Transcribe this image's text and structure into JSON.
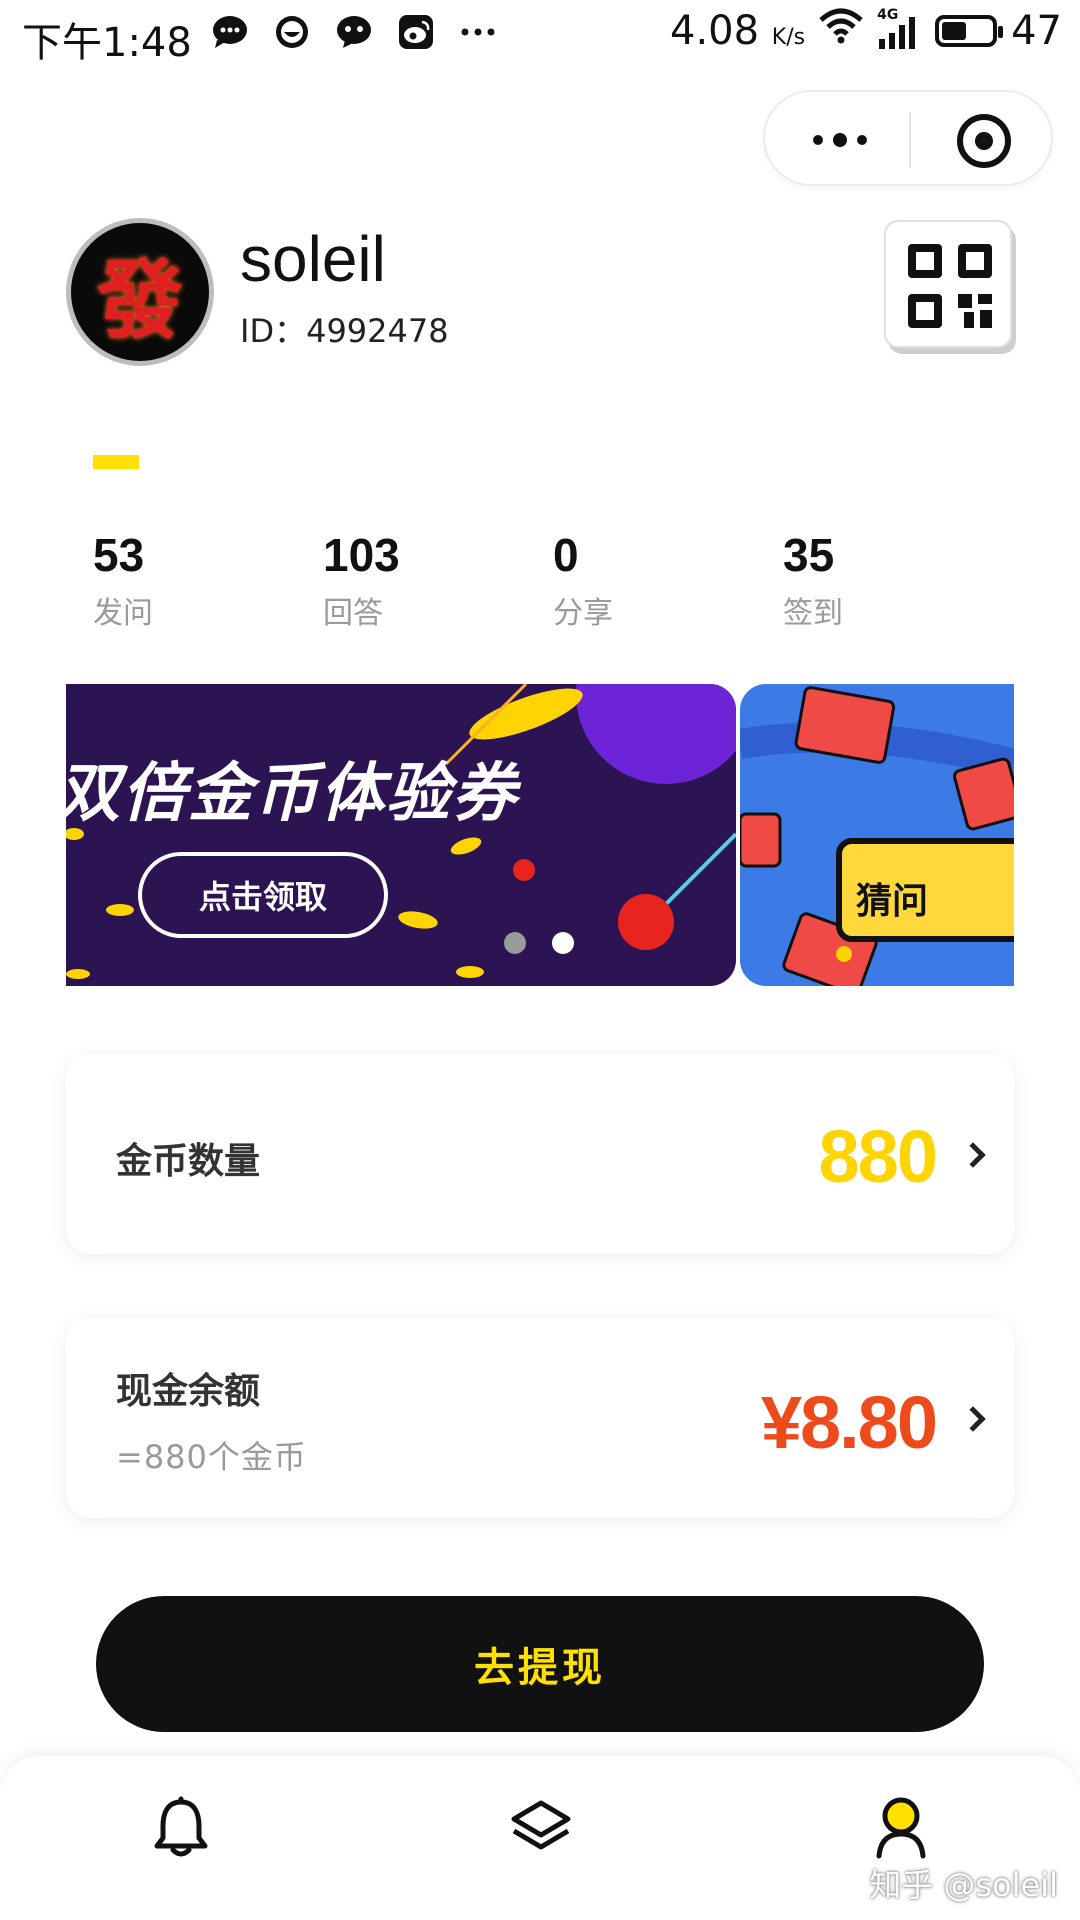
{
  "status_bar": {
    "time": "下午1:48",
    "speed_value": "4.08",
    "speed_unit": "K/s",
    "network": "4G",
    "battery": "47"
  },
  "capsule": {
    "more_icon": "ellipsis-icon",
    "close_icon": "target-circle-icon"
  },
  "profile": {
    "avatar_glyph": "發",
    "username": "soleil",
    "id_text": "ID：4992478",
    "qr_icon": "qr-code-icon"
  },
  "stats": [
    {
      "value": "53",
      "label": "发问"
    },
    {
      "value": "103",
      "label": "回答"
    },
    {
      "value": "0",
      "label": "分享"
    },
    {
      "value": "35",
      "label": "签到"
    }
  ],
  "banner": {
    "title": "双倍金币体验券",
    "button_label": "点击领取",
    "next_label": "猜问",
    "active_dot": 1,
    "dot_count": 2
  },
  "cards": {
    "coins": {
      "label": "金币数量",
      "value": "880"
    },
    "cash": {
      "label": "现金余额",
      "sub": "=880个金币",
      "value": "¥8.80"
    }
  },
  "withdraw_button": "去提现",
  "tabbar": {
    "tabs": [
      "bell-icon",
      "layers-icon",
      "profile-icon"
    ],
    "active_tab": 2
  },
  "watermark": "知乎 @soleil",
  "colors": {
    "accent_yellow": "#ffe000",
    "coin_yellow": "#ffd400",
    "cash_red": "#ee4b1c",
    "banner_purple": "#2c1352",
    "banner_blue": "#3c7ae6"
  }
}
